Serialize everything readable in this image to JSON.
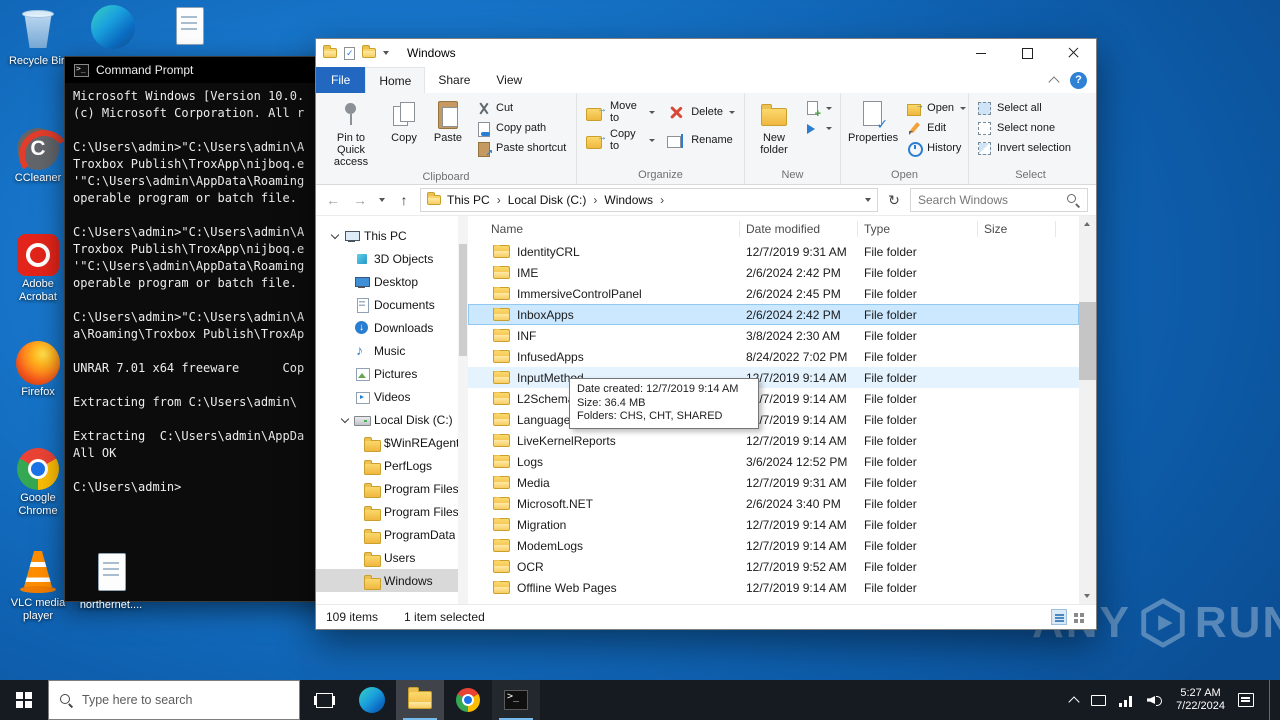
{
  "desktop": {
    "icons": [
      {
        "label": "Recycle Bin",
        "icon": "recycle-bin"
      },
      {
        "label": "",
        "icon": "edge"
      },
      {
        "label": "",
        "icon": "file"
      },
      {
        "label": "CCleaner",
        "icon": "ccleaner"
      },
      {
        "label": "Adobe Acrobat",
        "icon": "acrobat"
      },
      {
        "label": "Firefox",
        "icon": "firefox"
      },
      {
        "label": "Google Chrome",
        "icon": "chrome"
      },
      {
        "label": "VLC media player",
        "icon": "vlc"
      },
      {
        "label": "northernet....",
        "icon": "file"
      }
    ],
    "watermark": {
      "left": "ANY",
      "right": "RUN"
    }
  },
  "cmd": {
    "title": "Command Prompt",
    "lines": [
      "Microsoft Windows [Version 10.0.",
      "(c) Microsoft Corporation. All r",
      "",
      "C:\\Users\\admin>\"C:\\Users\\admin\\A",
      "Troxbox Publish\\TroxApp\\nijboq.e",
      "'\"C:\\Users\\admin\\AppData\\Roaming",
      "operable program or batch file.",
      "",
      "C:\\Users\\admin>\"C:\\Users\\admin\\A",
      "Troxbox Publish\\TroxApp\\nijboq.e",
      "'\"C:\\Users\\admin\\AppData\\Roaming",
      "operable program or batch file.",
      "",
      "C:\\Users\\admin>\"C:\\Users\\admin\\A",
      "a\\Roaming\\Troxbox Publish\\TroxAp",
      "",
      "UNRAR 7.01 x64 freeware      Cop",
      "",
      "Extracting from C:\\Users\\admin\\",
      "",
      "Extracting  C:\\Users\\admin\\AppDa",
      "All OK",
      "",
      "C:\\Users\\admin>"
    ]
  },
  "explorer": {
    "title": "Windows",
    "ribbon": {
      "tabs": [
        "File",
        "Home",
        "Share",
        "View"
      ],
      "groups": {
        "clipboard": {
          "label": "Clipboard",
          "pin": "Pin to Quick access",
          "copy": "Copy",
          "paste": "Paste",
          "cut": "Cut",
          "copy_path": "Copy path",
          "paste_shortcut": "Paste shortcut"
        },
        "organize": {
          "label": "Organize",
          "move_to": "Move to",
          "copy_to": "Copy to",
          "delete": "Delete",
          "rename": "Rename"
        },
        "new": {
          "label": "New",
          "new_folder": "New folder"
        },
        "open": {
          "label": "Open",
          "properties": "Properties",
          "open": "Open",
          "edit": "Edit",
          "history": "History"
        },
        "select": {
          "label": "Select",
          "select_all": "Select all",
          "select_none": "Select none",
          "invert_selection": "Invert selection"
        }
      }
    },
    "address": {
      "crumbs": [
        "This PC",
        "Local Disk (C:)",
        "Windows"
      ],
      "search_placeholder": "Search Windows"
    },
    "sidebar": {
      "items": [
        {
          "label": "This PC",
          "icon": "pc",
          "indent": 0,
          "arrow": true
        },
        {
          "label": "3D Objects",
          "icon": "objects",
          "indent": 1
        },
        {
          "label": "Desktop",
          "icon": "desktopi",
          "indent": 1
        },
        {
          "label": "Documents",
          "icon": "documents",
          "indent": 1
        },
        {
          "label": "Downloads",
          "icon": "downloads",
          "indent": 1
        },
        {
          "label": "Music",
          "icon": "music",
          "indent": 1
        },
        {
          "label": "Pictures",
          "icon": "pictures",
          "indent": 1
        },
        {
          "label": "Videos",
          "icon": "videos",
          "indent": 1
        },
        {
          "label": "Local Disk (C:)",
          "icon": "disk",
          "indent": 1,
          "arrow": true
        },
        {
          "label": "$WinREAgent",
          "icon": "folder",
          "indent": 2
        },
        {
          "label": "PerfLogs",
          "icon": "folder",
          "indent": 2
        },
        {
          "label": "Program Files",
          "icon": "folder",
          "indent": 2
        },
        {
          "label": "Program Files",
          "icon": "folder",
          "indent": 2
        },
        {
          "label": "ProgramData",
          "icon": "folder",
          "indent": 2
        },
        {
          "label": "Users",
          "icon": "folder",
          "indent": 2
        },
        {
          "label": "Windows",
          "icon": "folder",
          "indent": 2,
          "state": "selected"
        }
      ]
    },
    "files": {
      "columns": [
        "Name",
        "Date modified",
        "Type",
        "Size"
      ],
      "rows": [
        {
          "name": "IdentityCRL",
          "date": "12/7/2019 9:31 AM",
          "type": "File folder"
        },
        {
          "name": "IME",
          "date": "2/6/2024 2:42 PM",
          "type": "File folder"
        },
        {
          "name": "ImmersiveControlPanel",
          "date": "2/6/2024 2:45 PM",
          "type": "File folder"
        },
        {
          "name": "InboxApps",
          "date": "2/6/2024 2:42 PM",
          "type": "File folder",
          "state": "selected"
        },
        {
          "name": "INF",
          "date": "3/8/2024 2:30 AM",
          "type": "File folder"
        },
        {
          "name": "InfusedApps",
          "date": "8/24/2022 7:02 PM",
          "type": "File folder"
        },
        {
          "name": "InputMethod",
          "date": "12/7/2019 9:14 AM",
          "type": "File folder",
          "state": "hover"
        },
        {
          "name": "L2Schemas",
          "date": "12/7/2019 9:14 AM",
          "type": "File folder"
        },
        {
          "name": "LanguageOverlayCache",
          "date": "12/7/2019 9:14 AM",
          "type": "File folder"
        },
        {
          "name": "LiveKernelReports",
          "date": "12/7/2019 9:14 AM",
          "type": "File folder"
        },
        {
          "name": "Logs",
          "date": "3/6/2024 12:52 PM",
          "type": "File folder"
        },
        {
          "name": "Media",
          "date": "12/7/2019 9:31 AM",
          "type": "File folder"
        },
        {
          "name": "Microsoft.NET",
          "date": "2/6/2024 3:40 PM",
          "type": "File folder"
        },
        {
          "name": "Migration",
          "date": "12/7/2019 9:14 AM",
          "type": "File folder"
        },
        {
          "name": "ModemLogs",
          "date": "12/7/2019 9:14 AM",
          "type": "File folder"
        },
        {
          "name": "OCR",
          "date": "12/7/2019 9:52 AM",
          "type": "File folder"
        },
        {
          "name": "Offline Web Pages",
          "date": "12/7/2019 9:14 AM",
          "type": "File folder"
        }
      ]
    },
    "tooltip": {
      "lines": [
        "Date created: 12/7/2019 9:14 AM",
        "Size: 36.4 MB",
        "Folders: CHS, CHT, SHARED"
      ]
    },
    "status": {
      "items_count": "109 items",
      "selection": "1 item selected"
    }
  },
  "taskbar": {
    "search_placeholder": "Type here to search",
    "clock": {
      "time": "5:27 AM",
      "date": "7/22/2024"
    }
  }
}
